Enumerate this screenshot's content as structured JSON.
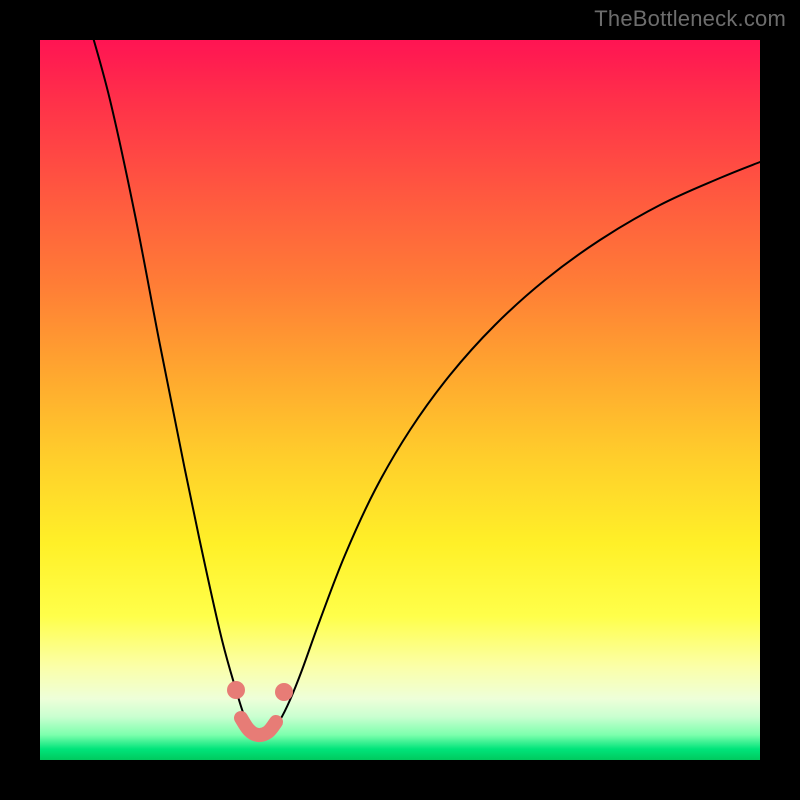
{
  "watermark": "TheBottleneck.com",
  "colors": {
    "gradient_top": "#ff1453",
    "gradient_mid": "#ffce2b",
    "gradient_bottom": "#00c95e",
    "curve": "#000000",
    "marker": "#e77c76",
    "frame": "#000000"
  },
  "chart_data": {
    "type": "line",
    "title": "",
    "xlabel": "",
    "ylabel": "",
    "x_range_plot": [
      0,
      720
    ],
    "y_range_plot": [
      0,
      720
    ],
    "note": "No numeric axes or tick labels are visible; values below are pixel-space coordinates within the 720×720 plot area (x right, y down). The curve is a V-shaped function with a narrow minimum near x≈215 touching the green band at the bottom, and an asymptotic rise toward the right.",
    "series": [
      {
        "name": "curve",
        "points_xy": [
          [
            48,
            -20
          ],
          [
            70,
            60
          ],
          [
            95,
            175
          ],
          [
            120,
            305
          ],
          [
            145,
            430
          ],
          [
            165,
            525
          ],
          [
            182,
            600
          ],
          [
            196,
            650
          ],
          [
            205,
            678
          ],
          [
            212,
            692
          ],
          [
            220,
            697
          ],
          [
            230,
            693
          ],
          [
            240,
            680
          ],
          [
            250,
            660
          ],
          [
            262,
            630
          ],
          [
            280,
            580
          ],
          [
            305,
            515
          ],
          [
            335,
            450
          ],
          [
            370,
            390
          ],
          [
            410,
            335
          ],
          [
            455,
            285
          ],
          [
            505,
            240
          ],
          [
            560,
            200
          ],
          [
            620,
            165
          ],
          [
            680,
            138
          ],
          [
            720,
            122
          ]
        ]
      }
    ],
    "markers_xy": [
      [
        196,
        650
      ],
      [
        244,
        652
      ]
    ],
    "valley_highlight_xy": [
      [
        201,
        678
      ],
      [
        209,
        690
      ],
      [
        218,
        695
      ],
      [
        228,
        692
      ],
      [
        236,
        682
      ]
    ]
  }
}
